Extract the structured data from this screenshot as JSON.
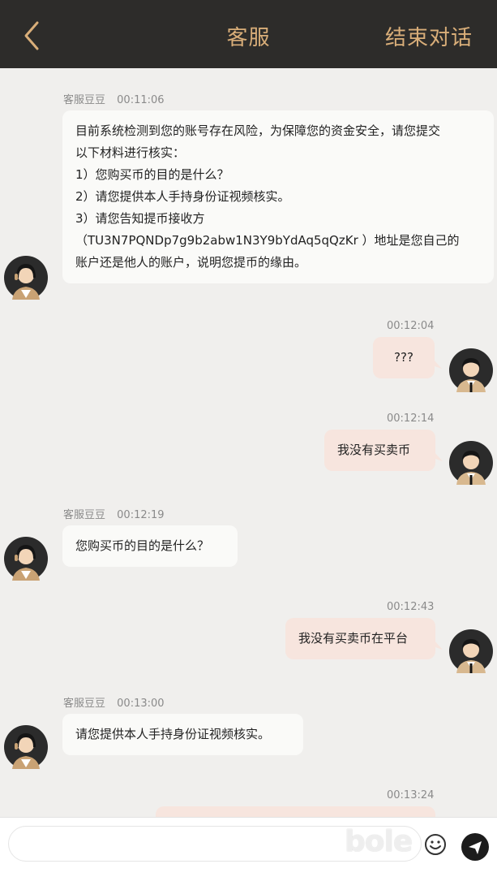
{
  "header": {
    "title": "客服",
    "end_chat_label": "结束对话",
    "accent_color": "#d9ae79",
    "background_color": "#2d2c2a"
  },
  "messages": [
    {
      "side": "in",
      "sender": "客服豆豆",
      "time": "00:11:06",
      "lines": [
        "目前系统检测到您的账号存在风险，为保障您的资金安全，请您提交",
        "以下材料进行核实：",
        "1）您购买币的目的是什么？",
        "2）请您提供本人手持身份证视频核实。",
        "3）请您告知提币接收方",
        "（TU3N7PQNDp7g9b2abw1N3Y9bYdAq5qQzKr ）地址是您自己的",
        "账户还是他人的账户，说明您提币的缘由。"
      ]
    },
    {
      "side": "out",
      "time": "00:12:04",
      "lines": [
        "???"
      ]
    },
    {
      "side": "out",
      "time": "00:12:14",
      "lines": [
        "我没有买卖币"
      ]
    },
    {
      "side": "in",
      "sender": "客服豆豆",
      "time": "00:12:19",
      "lines": [
        "您购买币的目的是什么？"
      ]
    },
    {
      "side": "out",
      "time": "00:12:43",
      "lines": [
        "我没有买卖币在平台"
      ]
    },
    {
      "side": "in",
      "sender": "客服豆豆",
      "time": "00:13:00",
      "lines": [
        "请您提供本人手持身份证视频核实。"
      ]
    },
    {
      "side": "out",
      "time": "00:13:24",
      "lines": [
        ""
      ]
    }
  ],
  "input": {
    "placeholder": ""
  },
  "icons": {
    "back": "chevron-left-icon",
    "emoji": "smiley-icon",
    "send": "send-icon",
    "agent_avatar": "female-agent-avatar",
    "user_avatar": "male-user-avatar"
  },
  "watermark": "bole"
}
